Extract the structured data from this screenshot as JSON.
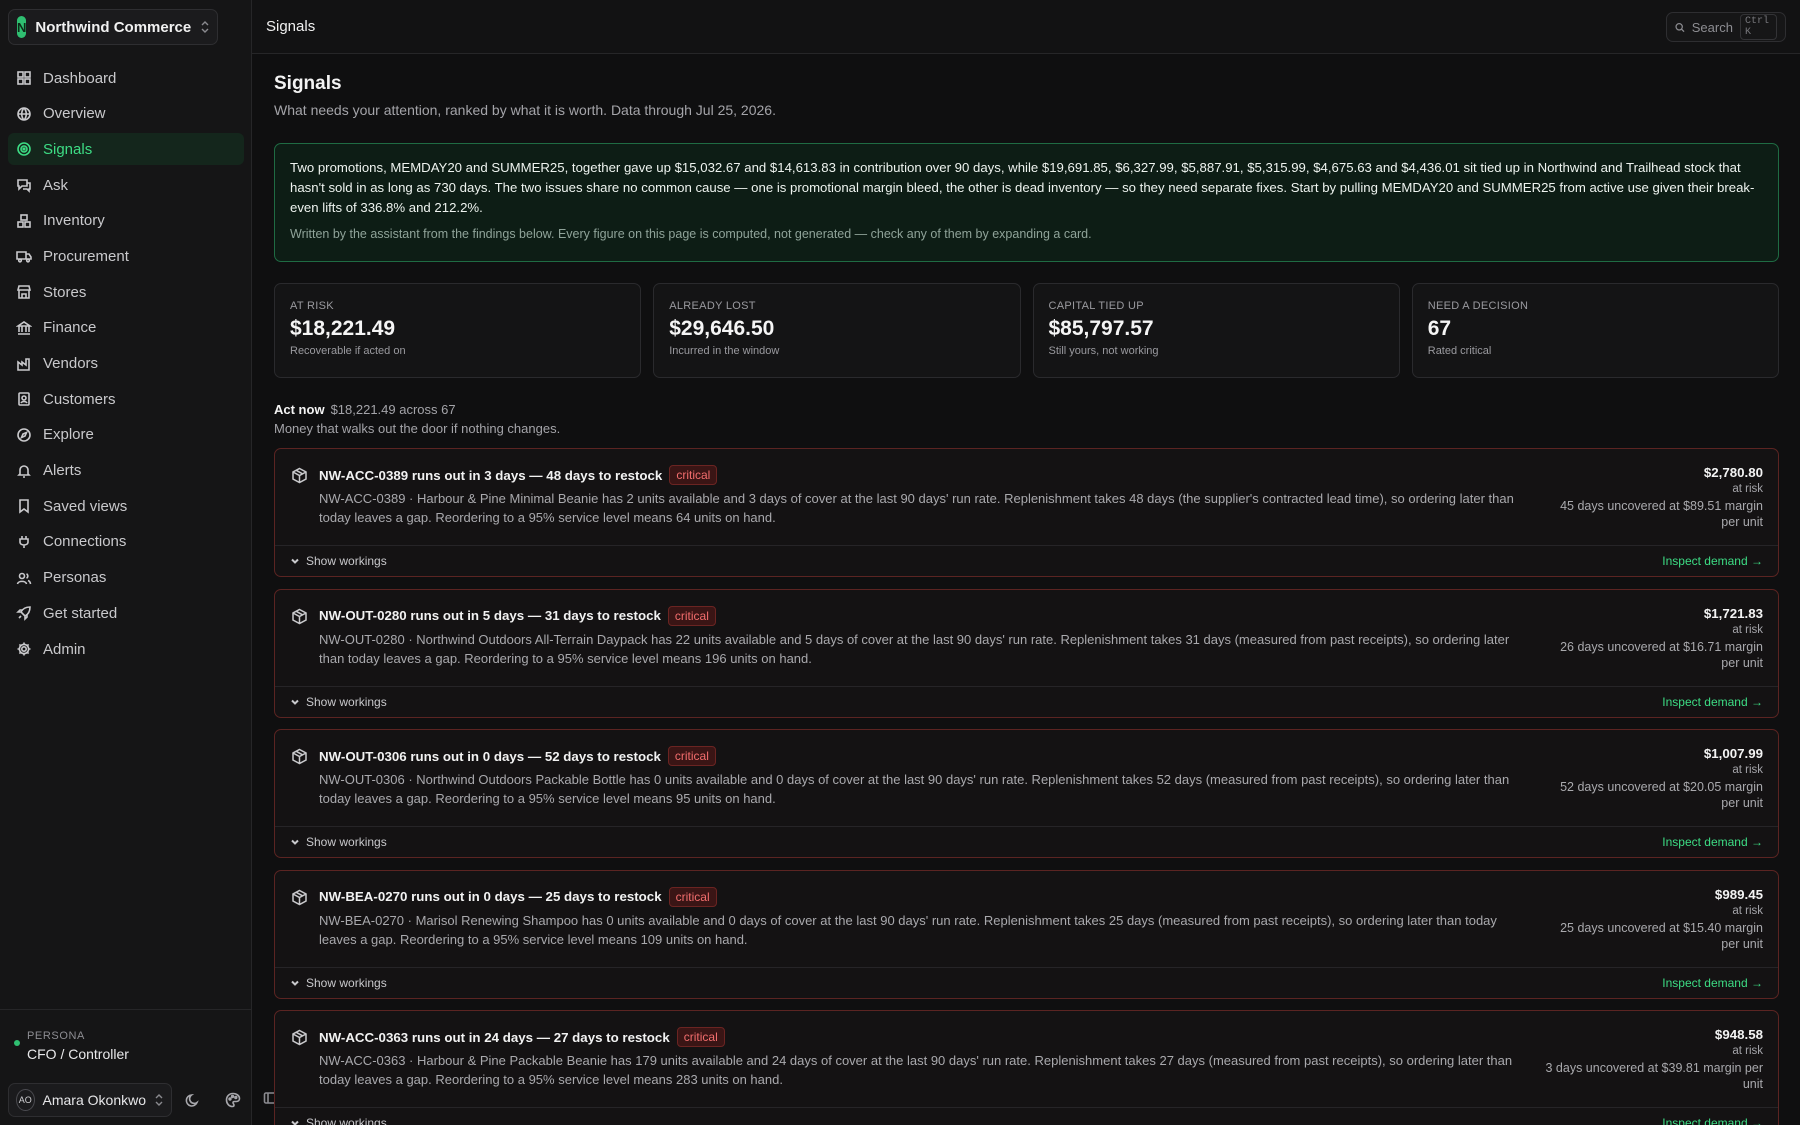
{
  "org": {
    "initial": "N",
    "name": "Northwind Commerce"
  },
  "nav": [
    {
      "label": "Dashboard",
      "icon": "layout-grid-icon"
    },
    {
      "label": "Overview",
      "icon": "globe-icon"
    },
    {
      "label": "Signals",
      "icon": "radar-icon",
      "active": true
    },
    {
      "label": "Ask",
      "icon": "chat-icon"
    },
    {
      "label": "Inventory",
      "icon": "boxes-icon"
    },
    {
      "label": "Procurement",
      "icon": "truck-icon"
    },
    {
      "label": "Stores",
      "icon": "store-icon"
    },
    {
      "label": "Finance",
      "icon": "bank-icon"
    },
    {
      "label": "Vendors",
      "icon": "factory-icon"
    },
    {
      "label": "Customers",
      "icon": "contact-icon"
    },
    {
      "label": "Explore",
      "icon": "compass-icon"
    },
    {
      "label": "Alerts",
      "icon": "bell-icon"
    },
    {
      "label": "Saved views",
      "icon": "bookmark-icon"
    },
    {
      "label": "Connections",
      "icon": "plug-icon"
    },
    {
      "label": "Personas",
      "icon": "users-icon"
    },
    {
      "label": "Get started",
      "icon": "rocket-icon"
    },
    {
      "label": "Admin",
      "icon": "gear-icon"
    }
  ],
  "persona": {
    "label": "PERSONA",
    "value": "CFO / Controller"
  },
  "user": {
    "initials": "AO",
    "name": "Amara Okonkwo"
  },
  "topbar": {
    "title": "Signals",
    "search_placeholder": "Search",
    "search_shortcut": "Ctrl K"
  },
  "page": {
    "title": "Signals",
    "subtitle": "What needs your attention, ranked by what it is worth. Data through Jul 25, 2026."
  },
  "summary": {
    "text": "Two promotions, MEMDAY20 and SUMMER25, together gave up $15,032.67 and $14,613.83 in contribution over 90 days, while $19,691.85, $6,327.99, $5,887.91, $5,315.99, $4,675.63 and $4,436.01 sit tied up in Northwind and Trailhead stock that hasn't sold in as long as 730 days. The two issues share no common cause — one is promotional margin bleed, the other is dead inventory — so they need separate fixes. Start by pulling MEMDAY20 and SUMMER25 from active use given their break-even lifts of 336.8% and 212.2%.",
    "note": "Written by the assistant from the findings below. Every figure on this page is computed, not generated — check any of them by expanding a card."
  },
  "kpis": [
    {
      "label": "AT RISK",
      "value": "$18,221.49",
      "caption": "Recoverable if acted on"
    },
    {
      "label": "ALREADY LOST",
      "value": "$29,646.50",
      "caption": "Incurred in the window"
    },
    {
      "label": "CAPITAL TIED UP",
      "value": "$85,797.57",
      "caption": "Still yours, not working"
    },
    {
      "label": "NEED A DECISION",
      "value": "67",
      "caption": "Rated critical"
    }
  ],
  "section": {
    "title": "Act now",
    "meta": "$18,221.49 across 67",
    "subtitle": "Money that walks out the door if nothing changes."
  },
  "card_labels": {
    "badge": "critical",
    "at_risk": "at risk",
    "show_workings": "Show workings",
    "inspect": "Inspect demand →"
  },
  "cards": [
    {
      "title": "NW-ACC-0389 runs out in 3 days — 48 days to restock",
      "body": "NW-ACC-0389 · Harbour & Pine Minimal Beanie has 2 units available and 3 days of cover at the last 90 days' run rate. Replenishment takes 48 days (the supplier's contracted lead time), so ordering later than today leaves a gap. Reordering to a 95% service level means 64 units on hand.",
      "amount": "$2,780.80",
      "uncovered": "45 days uncovered at $89.51 margin per unit"
    },
    {
      "title": "NW-OUT-0280 runs out in 5 days — 31 days to restock",
      "body": "NW-OUT-0280 · Northwind Outdoors All-Terrain Daypack has 22 units available and 5 days of cover at the last 90 days' run rate. Replenishment takes 31 days (measured from past receipts), so ordering later than today leaves a gap. Reordering to a 95% service level means 196 units on hand.",
      "amount": "$1,721.83",
      "uncovered": "26 days uncovered at $16.71 margin per unit"
    },
    {
      "title": "NW-OUT-0306 runs out in 0 days — 52 days to restock",
      "body": "NW-OUT-0306 · Northwind Outdoors Packable Bottle has 0 units available and 0 days of cover at the last 90 days' run rate. Replenishment takes 52 days (measured from past receipts), so ordering later than today leaves a gap. Reordering to a 95% service level means 95 units on hand.",
      "amount": "$1,007.99",
      "uncovered": "52 days uncovered at $20.05 margin per unit"
    },
    {
      "title": "NW-BEA-0270 runs out in 0 days — 25 days to restock",
      "body": "NW-BEA-0270 · Marisol Renewing Shampoo has 0 units available and 0 days of cover at the last 90 days' run rate. Replenishment takes 25 days (measured from past receipts), so ordering later than today leaves a gap. Reordering to a 95% service level means 109 units on hand.",
      "amount": "$989.45",
      "uncovered": "25 days uncovered at $15.40 margin per unit"
    },
    {
      "title": "NW-ACC-0363 runs out in 24 days — 27 days to restock",
      "body": "NW-ACC-0363 · Harbour & Pine Packable Beanie has 179 units available and 24 days of cover at the last 90 days' run rate. Replenishment takes 27 days (measured from past receipts), so ordering later than today leaves a gap. Reordering to a 95% service level means 283 units on hand.",
      "amount": "$948.58",
      "uncovered": "3 days uncovered at $39.81 margin per unit"
    }
  ]
}
